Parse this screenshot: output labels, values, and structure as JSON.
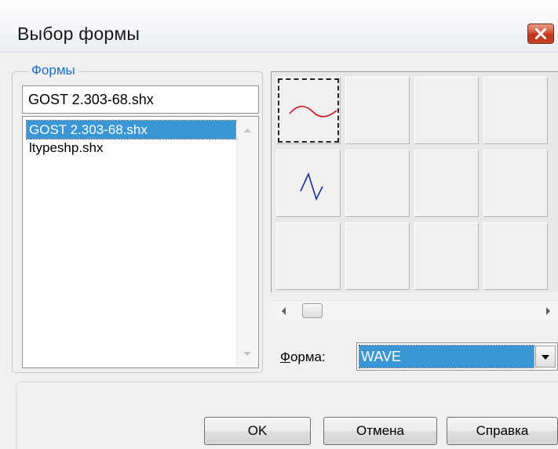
{
  "window": {
    "title": "Выбор формы"
  },
  "shapes_group": {
    "legend": "Формы",
    "input_value": "GOST 2.303-68.shx",
    "files": [
      {
        "label": "GOST 2.303-68.shx",
        "selected": true
      },
      {
        "label": "ltypeshp.shx",
        "selected": false
      }
    ]
  },
  "preview": {
    "cells": [
      {
        "shape": "wave",
        "color": "#c8141e",
        "focused": true
      },
      {
        "shape": "",
        "focused": false
      },
      {
        "shape": "",
        "focused": false
      },
      {
        "shape": "",
        "focused": false
      },
      {
        "shape": "zig",
        "color": "#1a2d9c",
        "focused": false
      },
      {
        "shape": "",
        "focused": false
      },
      {
        "shape": "",
        "focused": false
      },
      {
        "shape": "",
        "focused": false
      },
      {
        "shape": "",
        "focused": false
      },
      {
        "shape": "",
        "focused": false
      },
      {
        "shape": "",
        "focused": false
      },
      {
        "shape": "",
        "focused": false
      }
    ]
  },
  "shape_field": {
    "label_accel": "Ф",
    "label_rest": "орма:",
    "value": "WAVE"
  },
  "buttons": {
    "ok": "OK",
    "cancel": "Отмена",
    "help": "Справка"
  },
  "colors": {
    "selection": "#3b96d5",
    "legend_text": "#1e6bd6"
  }
}
